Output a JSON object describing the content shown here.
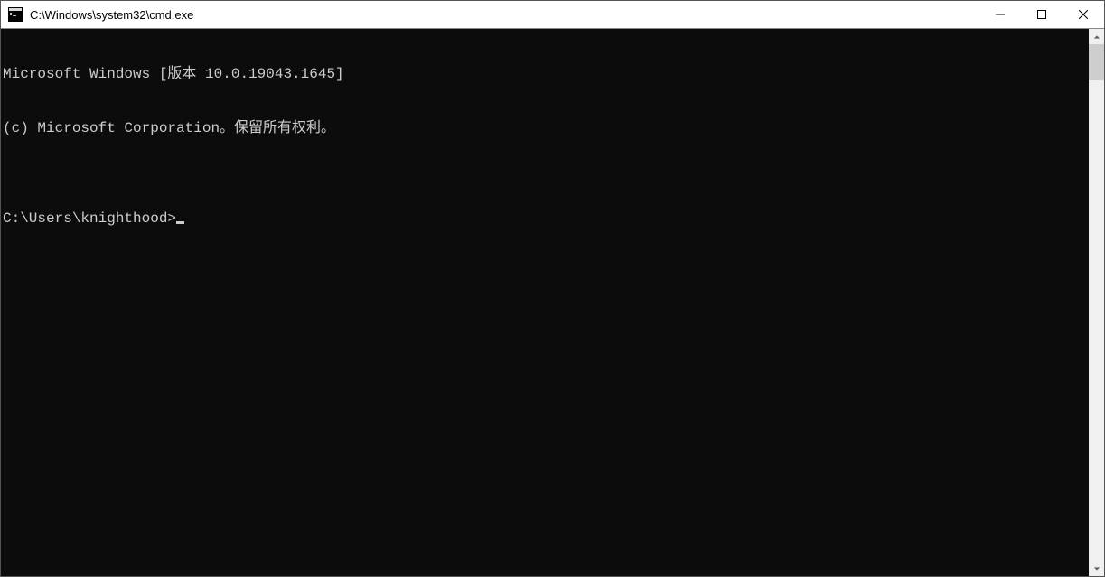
{
  "window": {
    "title": "C:\\Windows\\system32\\cmd.exe"
  },
  "console": {
    "line1": "Microsoft Windows [版本 10.0.19043.1645]",
    "line2": "(c) Microsoft Corporation。保留所有权利。",
    "blank": "",
    "prompt": "C:\\Users\\knighthood>"
  }
}
